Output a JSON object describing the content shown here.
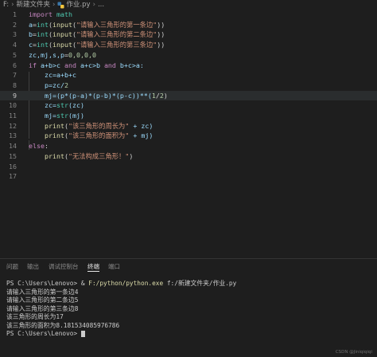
{
  "breadcrumb": {
    "drive": "F:",
    "folder": "新建文件夹",
    "file": "作业.py",
    "symbol": "..."
  },
  "editor": {
    "line_numbers": [
      "1",
      "2",
      "3",
      "4",
      "5",
      "6",
      "7",
      "8",
      "9",
      "10",
      "11",
      "12",
      "13",
      "14",
      "15",
      "16",
      "17"
    ],
    "active_line": "9"
  },
  "code": {
    "l1_kw": "import",
    "l1_mod": "math",
    "l2_var": "a",
    "l2_f1": "int",
    "l2_f2": "input",
    "l2_str": "\"请输入三角形的第一条边\"",
    "l3_var": "b",
    "l3_f1": "int",
    "l3_f2": "input",
    "l3_str": "\"请输入三角形的第二条边\"",
    "l4_var": "c",
    "l4_f1": "int",
    "l4_f2": "input",
    "l4_str": "\"请输入三角形的第三条边\"",
    "l5": "zc,mj,s,p",
    "l5_vals": "0,0,0,0",
    "l6_kw": "if",
    "l6_body": " a+b>c ",
    "l6_and1": "and",
    "l6_mid": " a+c>b ",
    "l6_and2": "and",
    "l6_end": " b+c>a:",
    "l7": "zc=a+b+c",
    "l8_a": "p=zc/",
    "l8_num": "2",
    "l9_a": "mj=(p*(p-a)*(p-b)*(p-c))**(",
    "l9_num": "1",
    "l9_b": "/",
    "l9_num2": "2",
    "l9_c": ")",
    "l10_a": "zc=",
    "l10_fn": "str",
    "l10_b": "(zc)",
    "l11_a": "mj=",
    "l11_fn": "str",
    "l11_b": "(mj)",
    "l12_fn": "print",
    "l12_str": "\"该三角形的周长为\"",
    "l12_b": " + zc)",
    "l13_fn": "print",
    "l13_str": "\"该三角形的面积为\"",
    "l13_b": " + mj)",
    "l14_kw": "else",
    "l14_b": ":",
    "l15_fn": "print",
    "l15_str": "\"无法构成三角形！\"",
    "l15_b": ")"
  },
  "panel": {
    "tabs": [
      "问题",
      "输出",
      "调试控制台",
      "终端",
      "端口"
    ],
    "active_tab": "终端"
  },
  "terminal": {
    "prompt1": "PS C:\\Users\\Lenovo> & ",
    "exe": "F:/python/python.exe",
    "args": " f:/新建文件夹/作业.py",
    "out1": "请输入三角形的第一条边4",
    "out2": "请输入三角形的第二条边5",
    "out3": "请输入三角形的第三条边8",
    "out4": "该三角形的周长为17",
    "out5": "该三角形的面积为8.181534085976786",
    "prompt2": "PS C:\\Users\\Lenovo> "
  },
  "watermark": "CSDN @Jiniqiqiqi",
  "colors": {
    "background": "#1e1e1e",
    "keyword": "#c586c0",
    "function": "#dcdcaa",
    "string": "#ce9178",
    "number": "#b5cea8",
    "variable": "#9cdcfe"
  }
}
